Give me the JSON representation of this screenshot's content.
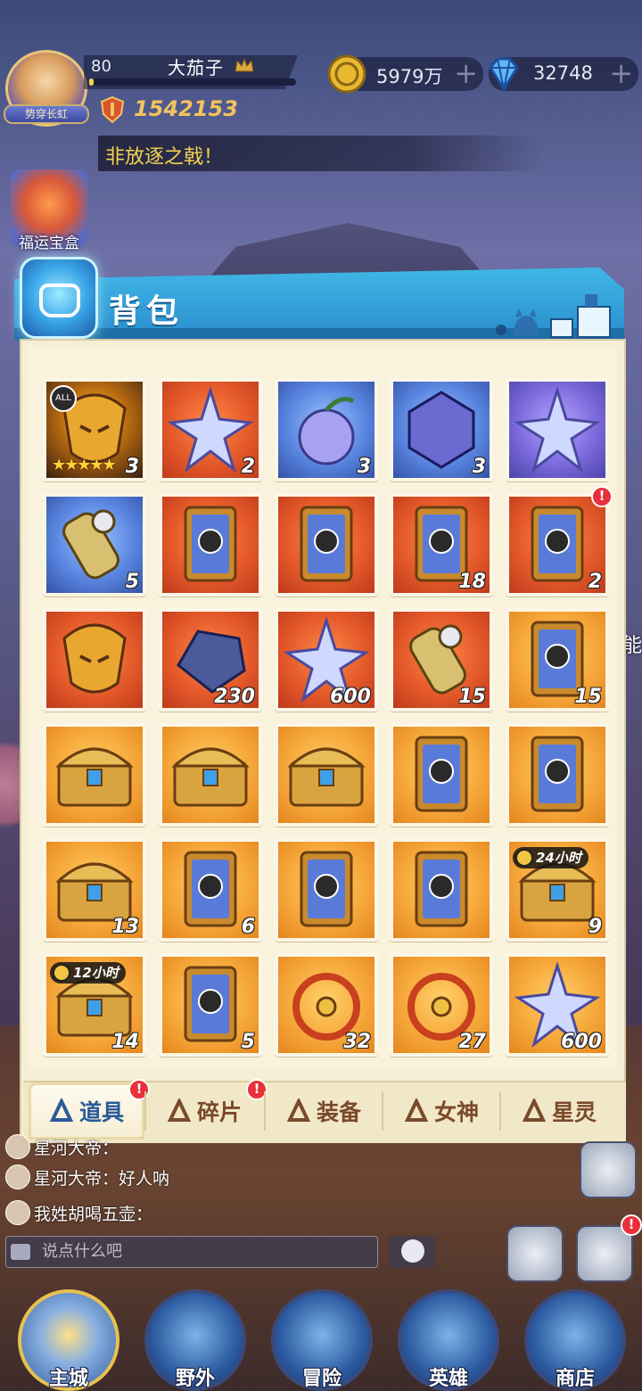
{
  "player": {
    "level": "80",
    "name": "大茄子",
    "title": "势穿长虹",
    "power": "1542153",
    "exp_fraction": 0.02
  },
  "resources": {
    "gold": "5979万",
    "gems": "32748"
  },
  "marquee": "非放逐之戟！",
  "gift_box_label": "福运宝盒",
  "panel": {
    "title": "背包"
  },
  "items": [
    {
      "quality": "q-legend",
      "count": "3",
      "icon": "golden-mask-icon",
      "badge": "ALL",
      "stars": "★★★★★"
    },
    {
      "quality": "q-red",
      "count": "2",
      "icon": "blue-crystal-icon"
    },
    {
      "quality": "q-blue",
      "count": "3",
      "icon": "fruit-icon"
    },
    {
      "quality": "q-blue",
      "count": "3",
      "icon": "rune-badge-icon"
    },
    {
      "quality": "q-purple",
      "count": "",
      "icon": "star-rune-icon"
    },
    {
      "quality": "q-blue",
      "count": "5",
      "icon": "scroll-icon"
    },
    {
      "quality": "q-red",
      "count": "",
      "icon": "card-pack-icon"
    },
    {
      "quality": "q-red",
      "count": "",
      "icon": "hero-card-icon"
    },
    {
      "quality": "q-red",
      "count": "18",
      "icon": "hero-puzzle-card-icon"
    },
    {
      "quality": "q-red",
      "count": "2",
      "icon": "hero-puzzle-card-icon",
      "alert": true
    },
    {
      "quality": "q-red",
      "count": "",
      "icon": "red-helmet-icon"
    },
    {
      "quality": "q-red",
      "count": "230",
      "icon": "dark-ore-icon"
    },
    {
      "quality": "q-red",
      "count": "600",
      "icon": "silver-star-icon"
    },
    {
      "quality": "q-red",
      "count": "15",
      "icon": "dark-scroll-icon"
    },
    {
      "quality": "q-orange",
      "count": "15",
      "icon": "hero-puzzle-card-icon"
    },
    {
      "quality": "q-orange",
      "count": "",
      "icon": "blue-chest-icon"
    },
    {
      "quality": "q-orange",
      "count": "",
      "icon": "royal-chest-icon"
    },
    {
      "quality": "q-orange",
      "count": "",
      "icon": "white-chest-icon"
    },
    {
      "quality": "q-orange",
      "count": "",
      "icon": "hero-card-icon"
    },
    {
      "quality": "q-orange",
      "count": "",
      "icon": "hero-card-icon"
    },
    {
      "quality": "q-orange",
      "count": "13",
      "icon": "green-chest-icon"
    },
    {
      "quality": "q-orange",
      "count": "6",
      "icon": "hero-puzzle-card-icon"
    },
    {
      "quality": "q-orange",
      "count": "",
      "icon": "mystery-card-icon"
    },
    {
      "quality": "q-orange",
      "count": "",
      "icon": "armor-card-icon"
    },
    {
      "quality": "q-orange",
      "count": "9",
      "icon": "gold-cart-icon",
      "timer": "24小时"
    },
    {
      "quality": "q-orange",
      "count": "14",
      "icon": "gold-barrel-icon",
      "timer": "12小时"
    },
    {
      "quality": "q-orange",
      "count": "5",
      "icon": "red-card-icon"
    },
    {
      "quality": "q-orange",
      "count": "32",
      "icon": "compass-wheel-icon"
    },
    {
      "quality": "q-orange",
      "count": "27",
      "icon": "gold-astrolabe-icon"
    },
    {
      "quality": "q-orange",
      "count": "600",
      "icon": "crystal-shard-icon"
    }
  ],
  "tabs": [
    {
      "label": "道具",
      "icon": "items-tab-icon",
      "alert": true
    },
    {
      "label": "碎片",
      "icon": "fragments-tab-icon",
      "alert": true
    },
    {
      "label": "装备",
      "icon": "equipment-tab-icon"
    },
    {
      "label": "女神",
      "icon": "goddess-tab-icon"
    },
    {
      "label": "星灵",
      "icon": "star-spirit-tab-icon"
    }
  ],
  "chat": {
    "lines": [
      {
        "text": "星河大帝："
      },
      {
        "text": "星河大帝：好人呐"
      },
      {
        "text": "我姓胡喝五壶："
      }
    ],
    "placeholder": "说点什么吧"
  },
  "side_text": "能",
  "nav": [
    {
      "label": "主城"
    },
    {
      "label": "野外"
    },
    {
      "label": "冒险"
    },
    {
      "label": "英雄"
    },
    {
      "label": "商店"
    }
  ]
}
